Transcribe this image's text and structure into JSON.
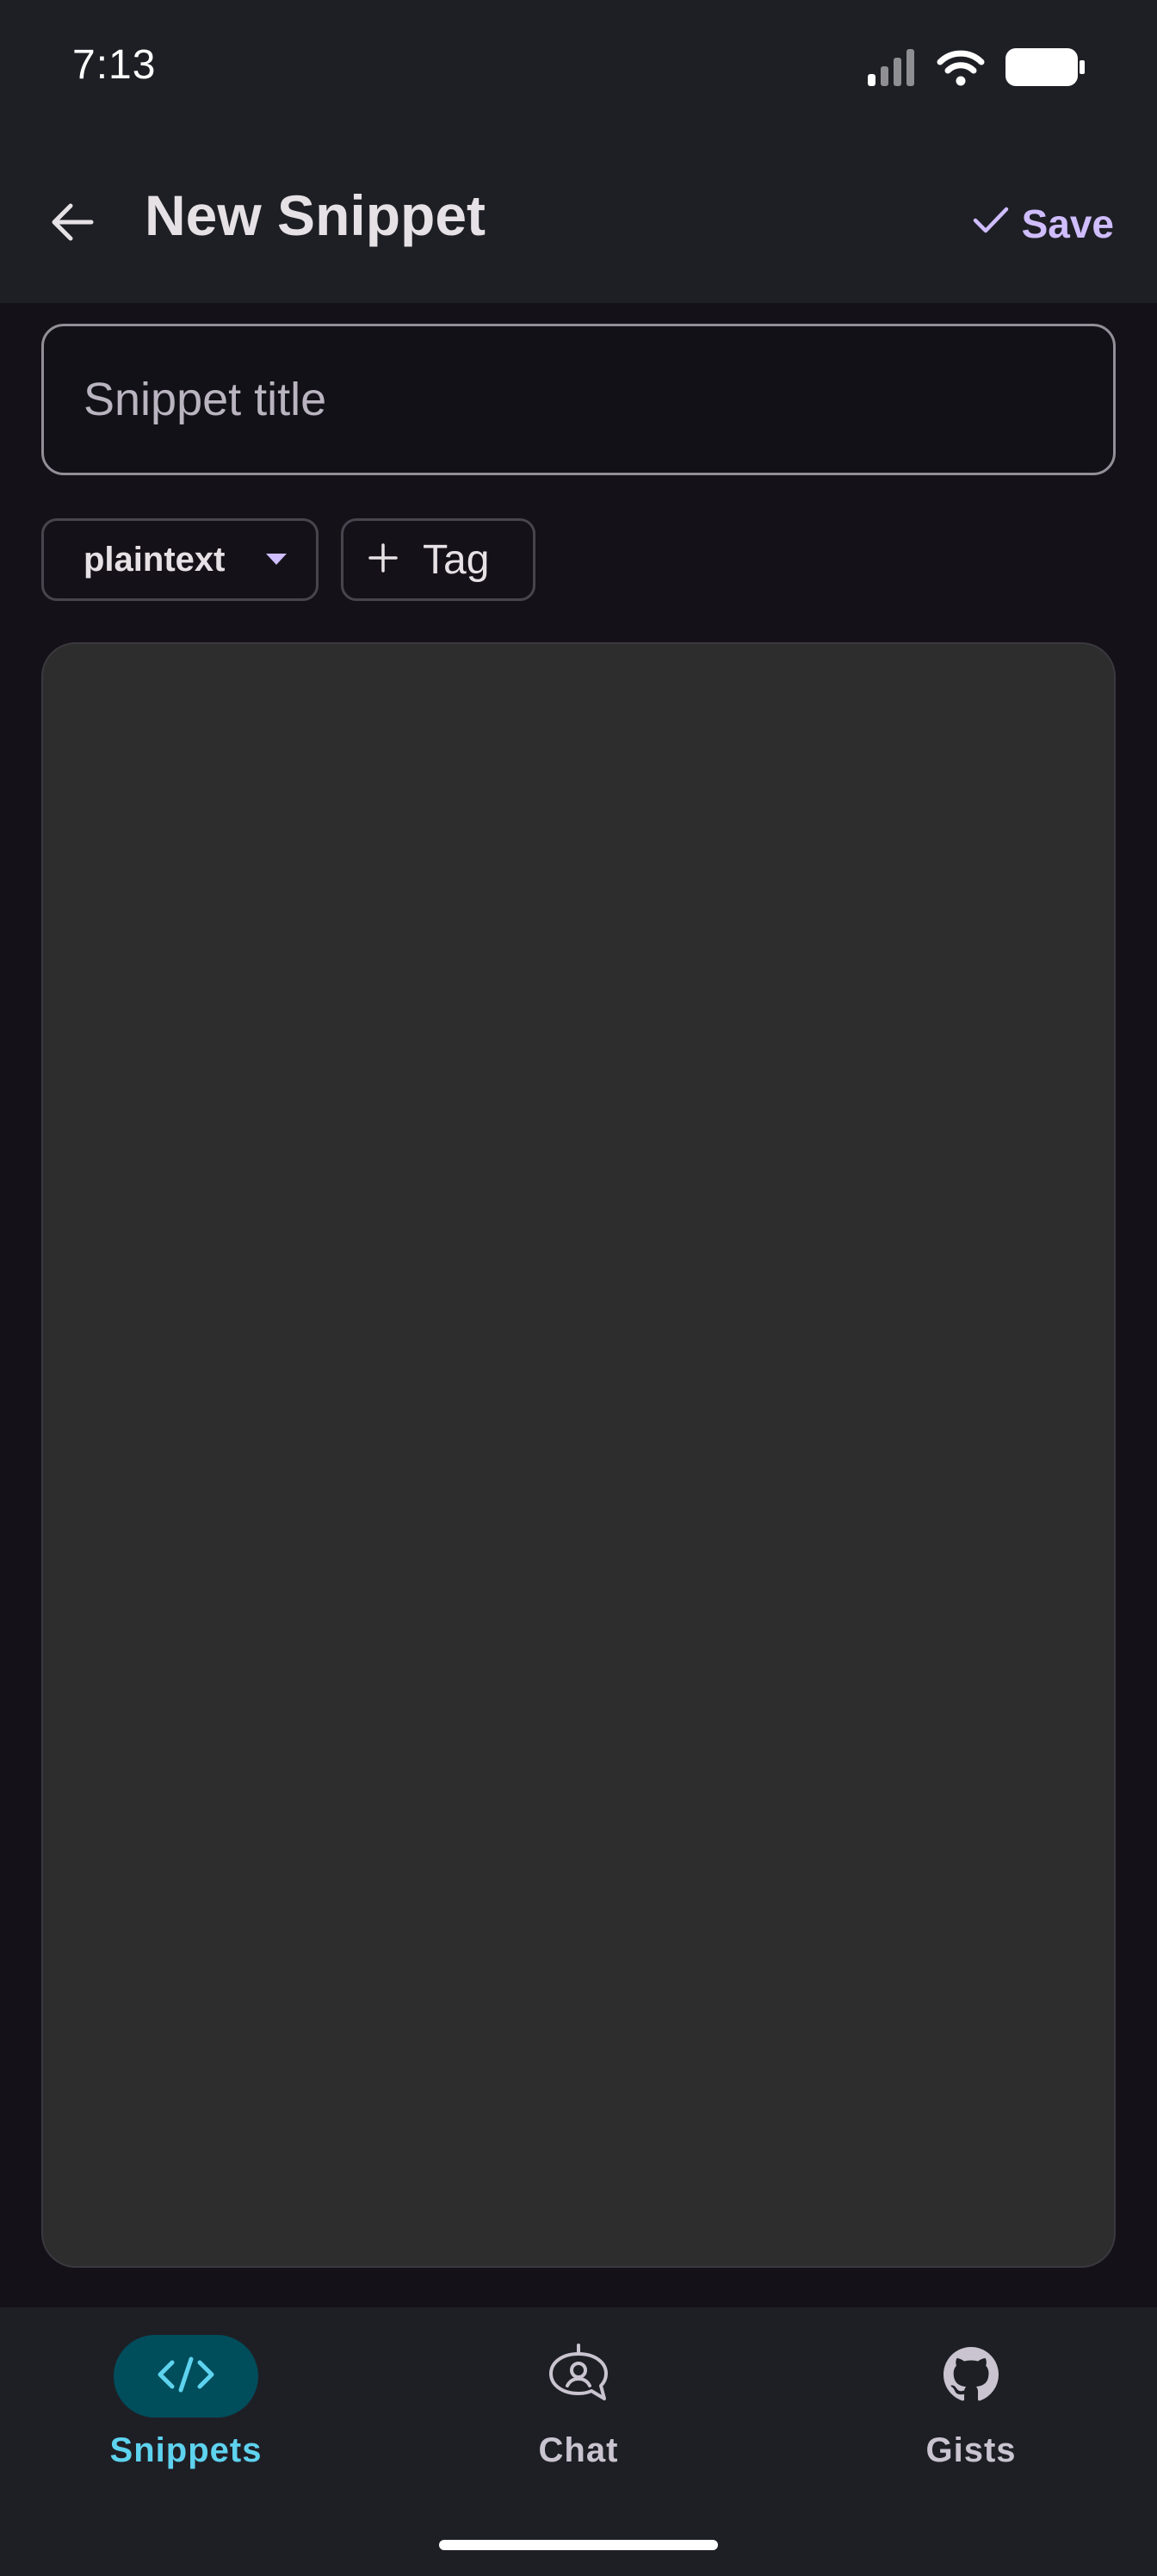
{
  "status_bar": {
    "time": "7:13",
    "icons": [
      "signal-icon",
      "wifi-icon",
      "battery-icon"
    ]
  },
  "app_bar": {
    "back_icon": "arrow-left-icon",
    "title": "New Snippet",
    "save_icon": "check-icon",
    "save_label": "Save"
  },
  "form": {
    "title_placeholder": "Snippet title",
    "title_value": "",
    "language_value": "plaintext",
    "tag_label": "Tag",
    "code_value": ""
  },
  "bottom_nav": {
    "items": [
      {
        "label": "Snippets",
        "icon": "code-icon",
        "active": true
      },
      {
        "label": "Chat",
        "icon": "chat-bot-icon",
        "active": false
      },
      {
        "label": "Gists",
        "icon": "github-icon",
        "active": false
      }
    ]
  },
  "colors": {
    "background": "#141218",
    "bar": "#1e1f25",
    "accent": "#cfbdfe",
    "nav_active": "#5ed3ef",
    "nav_active_bg": "#004d5c",
    "editor": "#2d2d2d"
  }
}
